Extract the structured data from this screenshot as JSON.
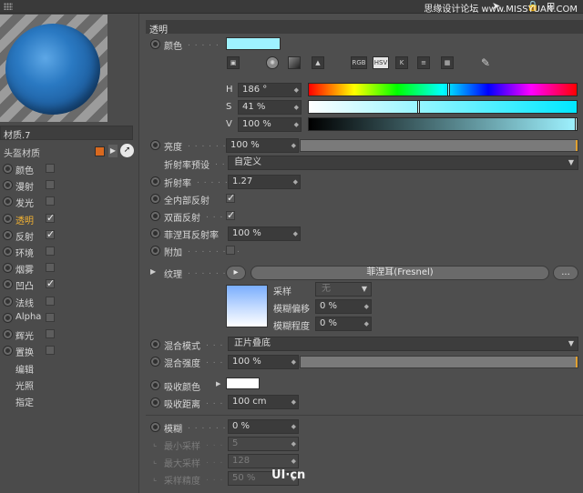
{
  "topbar": {
    "watermark": "思缘设计论坛 www.MISSYUAN.COM"
  },
  "material": {
    "name": "材质.7",
    "tag_label": "头盔材质",
    "tag_color": "#d9691f"
  },
  "channels": [
    {
      "label": "颜色",
      "checked": false
    },
    {
      "label": "漫射",
      "checked": false
    },
    {
      "label": "发光",
      "checked": false
    },
    {
      "label": "透明",
      "checked": true,
      "active": true
    },
    {
      "label": "反射",
      "checked": true
    },
    {
      "label": "环境",
      "checked": false
    },
    {
      "label": "烟雾",
      "checked": false
    },
    {
      "label": "凹凸",
      "checked": true
    },
    {
      "label": "法线",
      "checked": false
    },
    {
      "label": "Alpha",
      "checked": false
    },
    {
      "label": "辉光",
      "checked": false
    },
    {
      "label": "置换",
      "checked": false
    }
  ],
  "extra_items": [
    "编辑",
    "光照",
    "指定"
  ],
  "section": {
    "title": "透明"
  },
  "color": {
    "label": "颜色",
    "swatch": "#9ef2ff",
    "tools": [
      "picture-icon",
      "color-wheel-icon",
      "spectrum-icon",
      "image-icon",
      "RGB",
      "HSV",
      "K",
      "mixer-icon",
      "swatches-icon",
      "eyedropper-icon"
    ],
    "h_label": "H",
    "h_value": "186 °",
    "h_fraction": 0.52,
    "s_label": "S",
    "s_value": "41 %",
    "s_fraction": 0.41,
    "v_label": "V",
    "v_value": "100 %",
    "v_fraction": 1.0
  },
  "brightness": {
    "label": "亮度",
    "value": "100 %",
    "fraction": 1.0
  },
  "ior_preset": {
    "label": "折射率预设",
    "value": "自定义"
  },
  "ior": {
    "label": "折射率",
    "value": "1.27"
  },
  "total_internal": {
    "label": "全内部反射",
    "checked": true
  },
  "double_sided": {
    "label": "双面反射",
    "checked": true
  },
  "fresnel_reflectivity": {
    "label": "菲涅耳反射率",
    "value": "100 %"
  },
  "additive": {
    "label": "附加",
    "checked": false
  },
  "texture": {
    "label": "纹理",
    "shader_name": "菲涅耳(Fresnel)",
    "more": "...",
    "sampling_label": "采样",
    "sampling_value": "无",
    "blur_offset_label": "模糊偏移",
    "blur_offset_value": "0 %",
    "blur_scale_label": "模糊程度",
    "blur_scale_value": "0 %"
  },
  "mix_mode": {
    "label": "混合模式",
    "value": "正片叠底"
  },
  "mix_strength": {
    "label": "混合强度",
    "value": "100 %",
    "fraction": 1.0
  },
  "absorption_color": {
    "label": "吸收颜色",
    "swatch": "#ffffff"
  },
  "absorption_distance": {
    "label": "吸收距离",
    "value": "100 cm"
  },
  "blur": {
    "label": "模糊",
    "value": "0 %"
  },
  "min_samples": {
    "label": "最小采样",
    "value": "5"
  },
  "max_samples": {
    "label": "最大采样",
    "value": "128"
  },
  "sample_accuracy": {
    "label": "采样精度",
    "value": "50 %"
  },
  "corner_logo": "UI·cn"
}
